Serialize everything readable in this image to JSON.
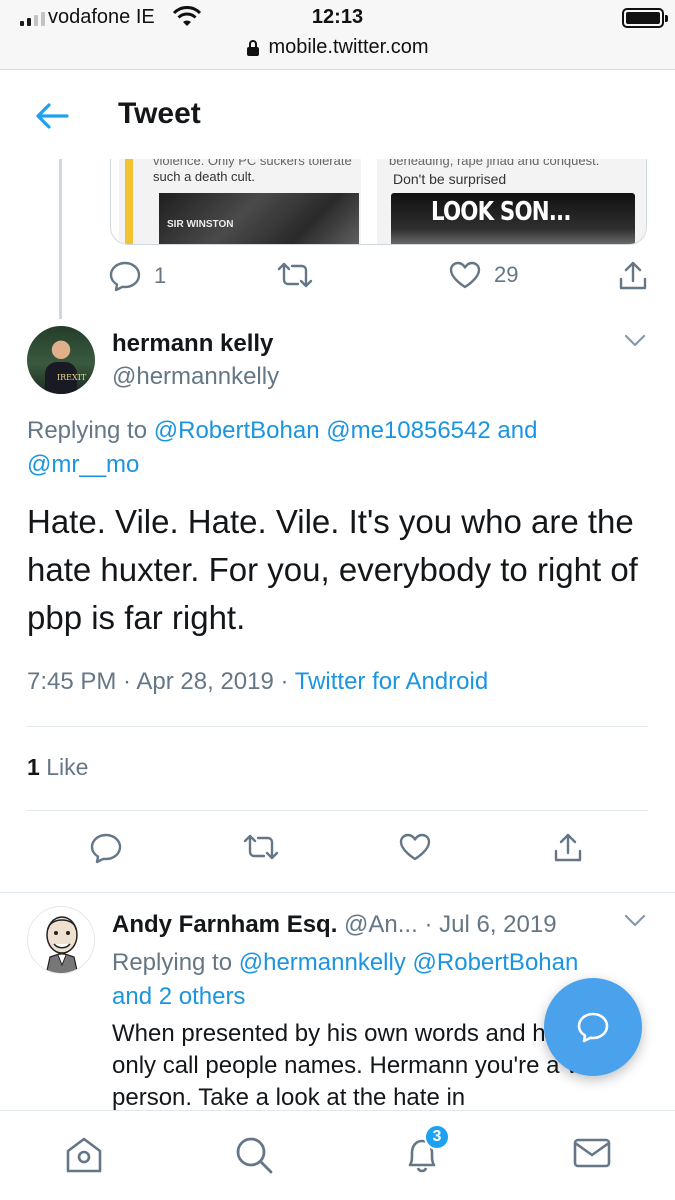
{
  "status_bar": {
    "carrier": "vodafone IE",
    "time": "12:13",
    "url": "mobile.twitter.com"
  },
  "header": {
    "title": "Tweet"
  },
  "context_tweet": {
    "media": {
      "left_caption": "such a death cult.",
      "left_cut_text": "violence. Only PC suckers tolerate",
      "left_photo_text": "SIR WINSTON",
      "right_cut_text": "beheading, rape jihad and conquest.",
      "right_caption": "Don't be surprised",
      "right_photo_text": "LOOK SON..."
    },
    "actions": {
      "replies": "1",
      "likes": "29"
    }
  },
  "main_tweet": {
    "name": "hermann kelly",
    "handle": "@hermannkelly",
    "avatar_text": "IREXIT",
    "replying_prefix": "Replying to",
    "replying_to": [
      "@RobertBohan",
      "@me10856542"
    ],
    "replying_and": "and",
    "replying_last": "@mr__mo",
    "text": "Hate. Vile. Hate. Vile. It's you who are the hate huxter. For you, everybody to right of pbp is far right.",
    "time": "7:45 PM",
    "date": "Apr 28, 2019",
    "source": "Twitter for Android",
    "likes_count": "1",
    "likes_label": "Like"
  },
  "reply_tweet": {
    "name": "Andy Farnham Esq.",
    "handle": "@An...",
    "date": "Jul 6, 2019",
    "replying_prefix": "Replying to",
    "replying_to": [
      "@hermannkelly",
      "@RobertBohan"
    ],
    "replying_others": "and 2 others",
    "text": "When presented by his own words and he can only call people names. Hermann you're a vile person. Take a look at the hate in"
  },
  "bottom_nav": {
    "notifications_badge": "3"
  },
  "colors": {
    "link": "#1b95e0",
    "muted": "#657786",
    "fab": "#4aa1ec",
    "badge": "#1da1f2"
  },
  "icons": [
    "back-arrow-icon",
    "reply-icon",
    "retweet-icon",
    "like-icon",
    "share-icon",
    "chevron-down-icon",
    "compose-reply-icon",
    "home-icon",
    "search-icon",
    "notifications-icon",
    "messages-icon"
  ]
}
